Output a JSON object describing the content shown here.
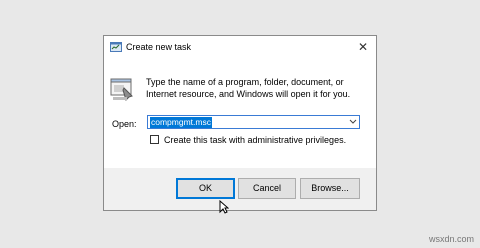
{
  "dialog": {
    "title": "Create new task",
    "close_glyph": "✕",
    "description": "Type the name of a program, folder, document, or Internet resource, and Windows will open it for you.",
    "open_label": "Open:",
    "open_value": "compmgmt.msc",
    "checkbox_label": "Create this task with administrative privileges.",
    "checkbox_checked": false,
    "buttons": {
      "ok": "OK",
      "cancel": "Cancel",
      "browse": "Browse..."
    }
  },
  "watermark": "wsxdn.com",
  "colors": {
    "selection": "#0078d7",
    "focus_border": "#0078d7",
    "background": "#e8e8e8"
  },
  "icons": {
    "title_icon": "task-manager-icon",
    "main_icon": "run-program-icon",
    "dropdown": "chevron-down-icon",
    "cursor": "mouse-pointer-icon"
  }
}
